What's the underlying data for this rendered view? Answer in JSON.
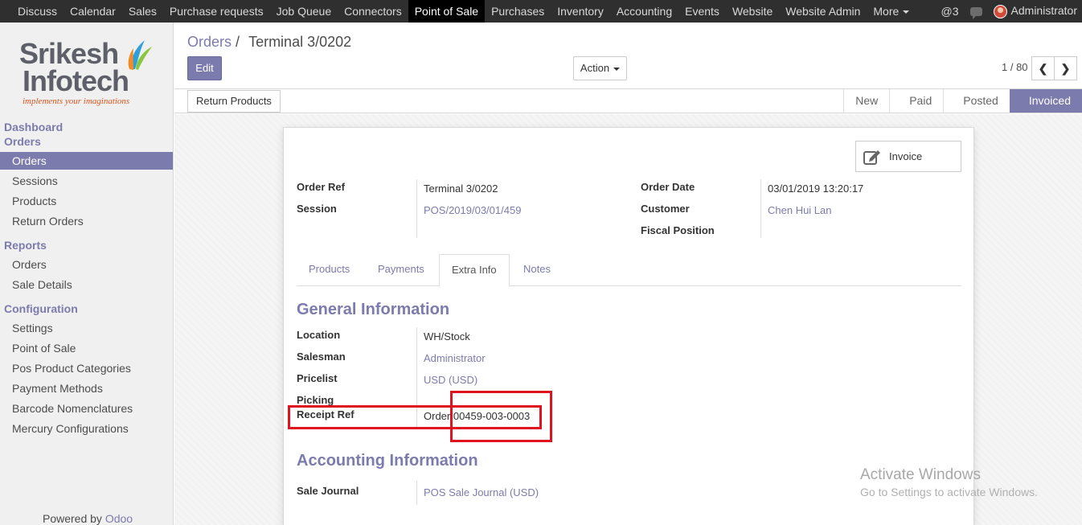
{
  "topnav": {
    "items": [
      "Discuss",
      "Calendar",
      "Sales",
      "Purchase requests",
      "Job Queue",
      "Connectors",
      "Point of Sale",
      "Purchases",
      "Inventory",
      "Accounting",
      "Events",
      "Website",
      "Website Admin",
      "More"
    ],
    "active": "Point of Sale",
    "mentions": "@3",
    "user": "Administrator"
  },
  "logo": {
    "line1": "Srikesh",
    "line2": "Infotech",
    "tagline": "implements your imaginations"
  },
  "sidebar": {
    "dashboard": "Dashboard",
    "orders_header": "Orders",
    "orders_items": [
      "Orders",
      "Sessions",
      "Products",
      "Return Orders"
    ],
    "reports_header": "Reports",
    "reports_items": [
      "Orders",
      "Sale Details"
    ],
    "config_header": "Configuration",
    "config_items": [
      "Settings",
      "Point of Sale",
      "Pos Product Categories",
      "Payment Methods",
      "Barcode Nomenclatures",
      "Mercury Configurations"
    ],
    "powered_prefix": "Powered by",
    "powered_brand": "Odoo"
  },
  "breadcrumb": {
    "parent": "Orders",
    "separator": "/",
    "current": "Terminal 3/0202"
  },
  "buttons": {
    "edit": "Edit",
    "action": "Action",
    "return_products": "Return Products",
    "invoice": "Invoice"
  },
  "pager": {
    "text": "1 / 80"
  },
  "stages": [
    "New",
    "Paid",
    "Posted",
    "Invoiced"
  ],
  "active_stage": "Invoiced",
  "header_fields": {
    "order_ref_label": "Order Ref",
    "order_ref": "Terminal 3/0202",
    "session_label": "Session",
    "session": "POS/2019/03/01/459",
    "order_date_label": "Order Date",
    "order_date": "03/01/2019 13:20:17",
    "customer_label": "Customer",
    "customer": "Chen Hui Lan",
    "fiscal_position_label": "Fiscal Position"
  },
  "tabs": [
    "Products",
    "Payments",
    "Extra Info",
    "Notes"
  ],
  "active_tab": "Extra Info",
  "general": {
    "title": "General Information",
    "location_label": "Location",
    "location": "WH/Stock",
    "salesman_label": "Salesman",
    "salesman": "Administrator",
    "pricelist_label": "Pricelist",
    "pricelist": "USD (USD)",
    "picking_label": "Picking",
    "receipt_ref_label": "Receipt Ref",
    "receipt_ref": "Order 00459-003-0003"
  },
  "accounting": {
    "title": "Accounting Information",
    "sale_journal_label": "Sale Journal",
    "sale_journal": "POS Sale Journal (USD)"
  },
  "watermark": {
    "line1": "Activate Windows",
    "line2": "Go to Settings to activate Windows."
  },
  "colors": {
    "brand": "#7c7bad",
    "topbar": "#2f2f2f",
    "highlight": "#e0141e",
    "logo_accent": "#d9541e"
  }
}
